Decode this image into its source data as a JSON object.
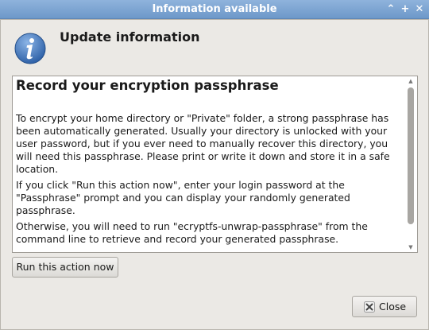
{
  "window": {
    "title": "Information available",
    "controls": {
      "chevron": "⌃",
      "maximize": "+",
      "close": "✕"
    }
  },
  "header": {
    "title": "Update information",
    "icon": "info-icon"
  },
  "content": {
    "heading": "Record your encryption passphrase",
    "paragraphs": [
      "To encrypt your home directory or \"Private\" folder, a strong passphrase has been automatically generated. Usually your directory is unlocked with your user password, but if you ever need to manually recover this directory, you will need this passphrase. Please print or write it down and store it in a safe location.",
      "If you click \"Run this action now\", enter your login password at the \"Passphrase\" prompt and you can display your randomly generated passphrase.",
      "Otherwise, you will need to run \"ecryptfs-unwrap-passphrase\" from the command line to retrieve and record your generated passphrase."
    ]
  },
  "buttons": {
    "run": "Run this action now",
    "close": "Close"
  },
  "colors": {
    "titlebar": "#7fa6d4",
    "icon_blue": "#3f74b8"
  }
}
